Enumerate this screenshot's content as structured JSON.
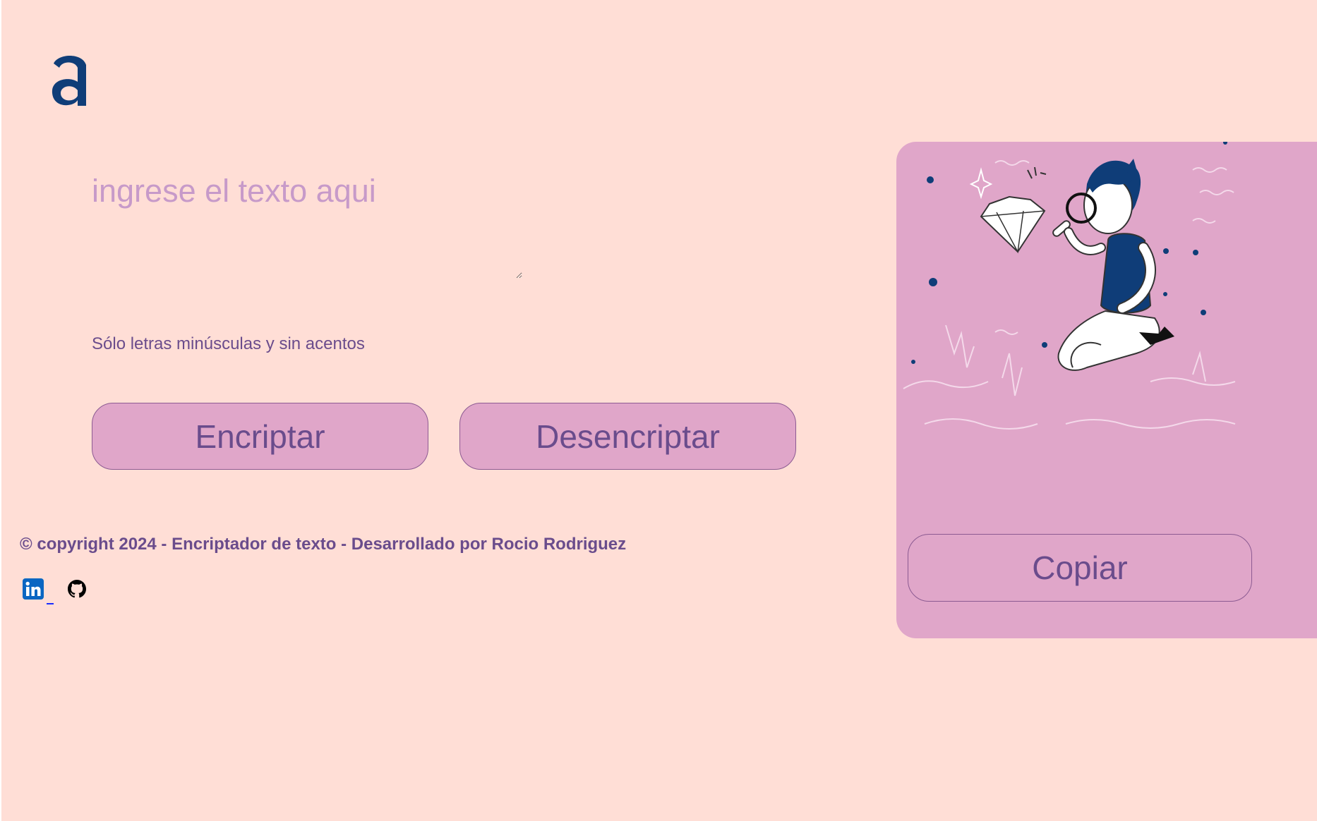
{
  "brand": {
    "logo_icon": "alura-logo-icon",
    "color": "#0f3d78"
  },
  "input": {
    "placeholder": "ingrese el texto aqui",
    "value": ""
  },
  "hint": {
    "text": "Sólo letras minúsculas y sin acentos"
  },
  "actions": {
    "encrypt_label": "Encriptar",
    "decrypt_label": "Desencriptar"
  },
  "output": {
    "illustration_icon": "person-with-magnifier-illustration",
    "copy_label": "Copiar"
  },
  "footer": {
    "copyright": "© copyright 2024 - Encriptador de texto - Desarrollado por Rocio Rodriguez",
    "social": [
      {
        "name": "linkedin-icon",
        "color": "#0a66c2"
      },
      {
        "name": "github-icon",
        "color": "#000000"
      }
    ]
  },
  "colors": {
    "background": "#ffded6",
    "panel": "#e0a6c9",
    "text_accent": "#6a4c8c",
    "placeholder": "#c79ac9"
  }
}
